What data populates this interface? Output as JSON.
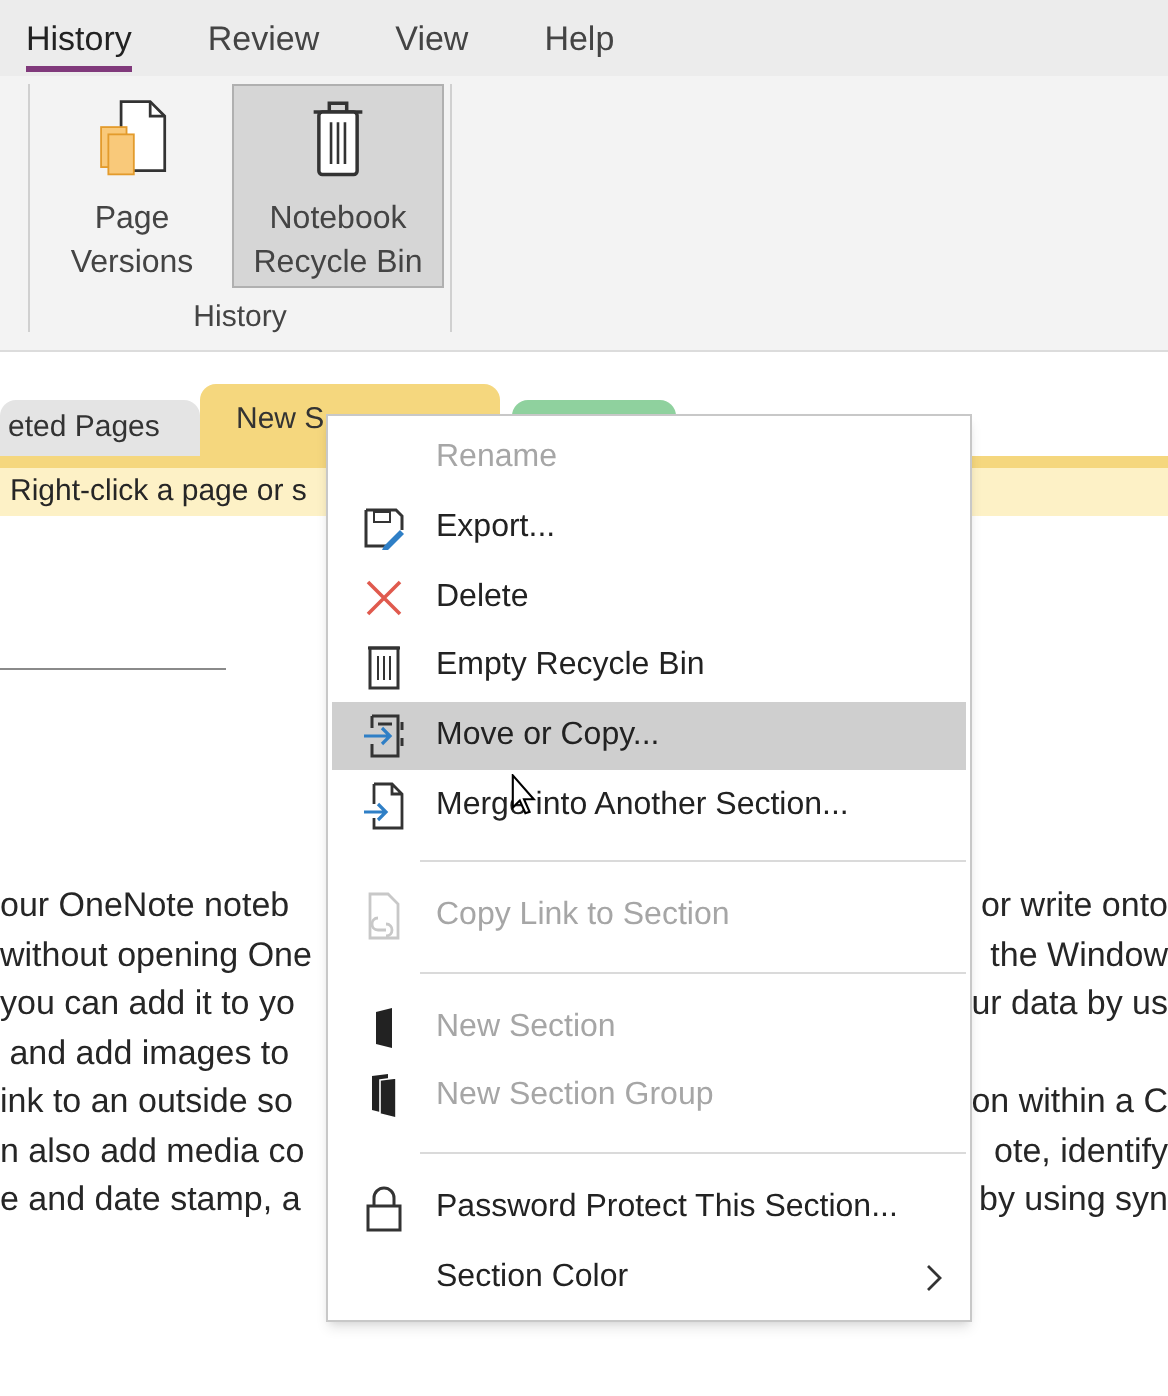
{
  "ribbon_tabs": [
    {
      "label": "History",
      "selected": true
    },
    {
      "label": "Review",
      "selected": false
    },
    {
      "label": "View",
      "selected": false
    },
    {
      "label": "Help",
      "selected": false
    }
  ],
  "ribbon": {
    "buttons": [
      {
        "label": "Page Versions",
        "pressed": false
      },
      {
        "label": "Notebook Recycle Bin",
        "pressed": true
      }
    ],
    "group_label": "History"
  },
  "section_tabs": [
    {
      "label": "eted Pages",
      "color": "#e4e4e4",
      "selected": false
    },
    {
      "label": "New S",
      "color": "#f5d77e",
      "selected": true
    },
    {
      "color": "#8fd19e",
      "selected": false
    }
  ],
  "info_bar": {
    "text": "Right-click a page or s"
  },
  "page": {
    "lines": [
      {
        "left": "our OneNote noteb",
        "right": "or write onto"
      },
      {
        "left": "without opening One",
        "right": "the Window"
      },
      {
        "left": "you can add it to yo",
        "right": "ur data by us"
      },
      {
        "left": " and add images to"
      },
      {
        "left": "ink to an outside so",
        "right": "on within a C"
      },
      {
        "left": "n also add media co",
        "right": "ote, identify"
      },
      {
        "left": "e and date stamp, a",
        "right": "by using syn"
      }
    ]
  },
  "context_menu": {
    "items": [
      {
        "kind": "item",
        "label": "Rename",
        "disabled": true,
        "selected": false
      },
      {
        "kind": "item",
        "label": "Export...",
        "disabled": false,
        "selected": false
      },
      {
        "kind": "item",
        "label": "Delete",
        "disabled": false,
        "selected": false
      },
      {
        "kind": "item",
        "label": "Empty Recycle Bin",
        "disabled": false,
        "selected": false
      },
      {
        "kind": "item",
        "label": "Move or Copy...",
        "disabled": false,
        "selected": true
      },
      {
        "kind": "item",
        "label": "Merge into Another Section...",
        "disabled": false,
        "selected": false
      },
      {
        "kind": "separator"
      },
      {
        "kind": "item",
        "label": "Copy Link to Section",
        "disabled": true,
        "selected": false
      },
      {
        "kind": "separator"
      },
      {
        "kind": "item",
        "label": "New Section",
        "disabled": true,
        "selected": false
      },
      {
        "kind": "item",
        "label": "New Section Group",
        "disabled": true,
        "selected": false
      },
      {
        "kind": "separator"
      },
      {
        "kind": "item",
        "label": "Password Protect This Section...",
        "disabled": false,
        "selected": false
      },
      {
        "kind": "submenu",
        "label": "Section Color",
        "disabled": false,
        "selected": false
      }
    ]
  }
}
